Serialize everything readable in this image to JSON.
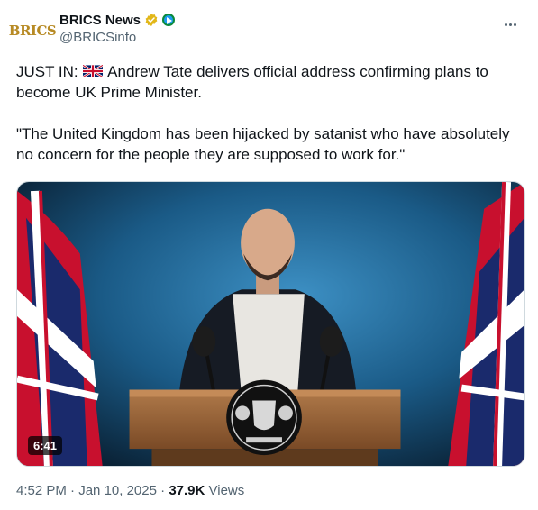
{
  "account": {
    "avatar_text": "BRICS",
    "display_name": "BRICS News",
    "handle": "@BRICSinfo",
    "verified_badge_color": "#e2b719",
    "icons": [
      "verified-badge-icon",
      "affiliate-badge-icon",
      "more-icon"
    ]
  },
  "tweet": {
    "line1_prefix": "JUST IN:",
    "line1_flag": "uk-flag-emoji",
    "line1_text": "Andrew Tate delivers official address confirming plans to become UK Prime Minister.",
    "quote": "\"The United Kingdom has been hijacked by satanist who have absolutely no concern for the people they are supposed to work for.\""
  },
  "media": {
    "type": "video",
    "duration": "6:41"
  },
  "meta": {
    "time": "4:52 PM",
    "separator1": "·",
    "date": "Jan 10, 2025",
    "separator2": "·",
    "views_count": "37.9K",
    "views_label": "Views"
  },
  "colors": {
    "text": "#0f1419",
    "secondary": "#536471",
    "backdrop_blue": "#1e6a9e"
  }
}
